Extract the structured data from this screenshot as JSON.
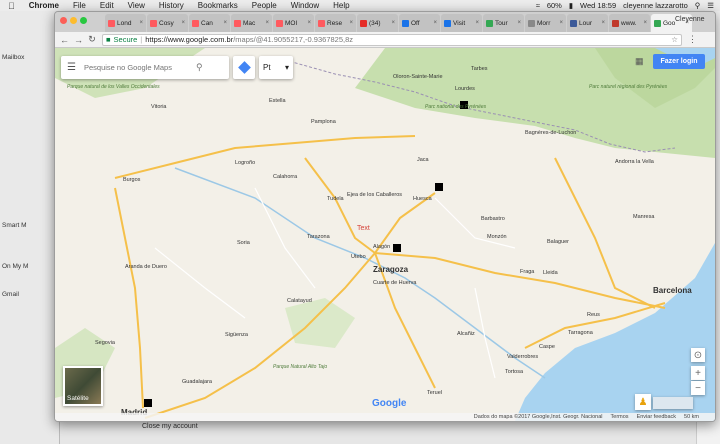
{
  "menubar": {
    "app": "Chrome",
    "items": [
      "File",
      "Edit",
      "View",
      "History",
      "Bookmarks",
      "People",
      "Window",
      "Help"
    ],
    "battery": "60%",
    "clock": "Wed 18:59",
    "user": "cleyenne lazzarotto"
  },
  "browser": {
    "profile": "Cleyenne",
    "tabs": [
      {
        "title": "Lond",
        "color": "#ff5a5f"
      },
      {
        "title": "Cosy",
        "color": "#ff5a5f"
      },
      {
        "title": "Can",
        "color": "#ff5a5f"
      },
      {
        "title": "Mac",
        "color": "#ff5a5f"
      },
      {
        "title": "MOI",
        "color": "#ff5a5f"
      },
      {
        "title": "Rese",
        "color": "#ff5a5f"
      },
      {
        "title": "(34)",
        "color": "#e52d27"
      },
      {
        "title": "Off",
        "color": "#1a73e8"
      },
      {
        "title": "Visit",
        "color": "#1a73e8"
      },
      {
        "title": "Tour",
        "color": "#34a853"
      },
      {
        "title": "Morr",
        "color": "#888888"
      },
      {
        "title": "Lour",
        "color": "#3b5998"
      },
      {
        "title": "www.",
        "color": "#c0392b"
      },
      {
        "title": "Goo",
        "color": "#34a853"
      }
    ],
    "url_secure": "Secure",
    "url_host": "https://www.google.com.br",
    "url_path": "/maps/@41.9055217,-0.9367825,8z"
  },
  "maps": {
    "search_placeholder": "Pesquise no Google Maps",
    "language": "Pt",
    "login": "Fazer login",
    "satellite": "Satélite",
    "logo": "Google",
    "footer": [
      "Dados do mapa ©2017 Google,Inst. Geogr. Nacional",
      "Termos",
      "Enviar feedback",
      "50 km"
    ],
    "text_annotation": "Text",
    "cities": [
      {
        "name": "Zaragoza",
        "major": true
      },
      {
        "name": "Huesca"
      },
      {
        "name": "Pamplona"
      },
      {
        "name": "Logroño"
      },
      {
        "name": "Burgos"
      },
      {
        "name": "Soria"
      },
      {
        "name": "Lleida"
      },
      {
        "name": "Barcelona",
        "major": true
      },
      {
        "name": "Tarragona"
      },
      {
        "name": "Teruel"
      },
      {
        "name": "Guadalajara"
      },
      {
        "name": "Madrid",
        "major": true
      },
      {
        "name": "Lourdes"
      },
      {
        "name": "Tarbes"
      },
      {
        "name": "Oloron-Sainte-Marie"
      },
      {
        "name": "Calahorra"
      },
      {
        "name": "Tudela"
      },
      {
        "name": "Tarazona"
      },
      {
        "name": "Ejea de los Caballeros"
      },
      {
        "name": "Barbastro"
      },
      {
        "name": "Monzón"
      },
      {
        "name": "Fraga"
      },
      {
        "name": "Alcañiz"
      },
      {
        "name": "Calatayud"
      },
      {
        "name": "Segovia"
      },
      {
        "name": "Aranda de Duero"
      },
      {
        "name": "Sigüenza"
      },
      {
        "name": "Manresa"
      },
      {
        "name": "Tortosa"
      },
      {
        "name": "Reus"
      },
      {
        "name": "Balaguer"
      },
      {
        "name": "Jaca"
      },
      {
        "name": "Estella"
      },
      {
        "name": "Vitoria"
      },
      {
        "name": "Bagnères-de-Luchon"
      },
      {
        "name": "Andorra la Vella"
      },
      {
        "name": "Alagón"
      },
      {
        "name": "Caspe"
      },
      {
        "name": "Valderrobres"
      },
      {
        "name": "Cuarte de Huerva"
      },
      {
        "name": "Utebo"
      }
    ],
    "parks": [
      "Parc naturel régional des Pyrénées",
      "Parc national des Pyrénées",
      "Parque Natural Alto Tajo",
      "Parque natural de los Valles Occidentales"
    ]
  },
  "background_app": {
    "sidebar_rows": [
      "Mailbox",
      "Smart M",
      "On My M",
      "Gmail"
    ],
    "bottom_text": "Close my account"
  }
}
